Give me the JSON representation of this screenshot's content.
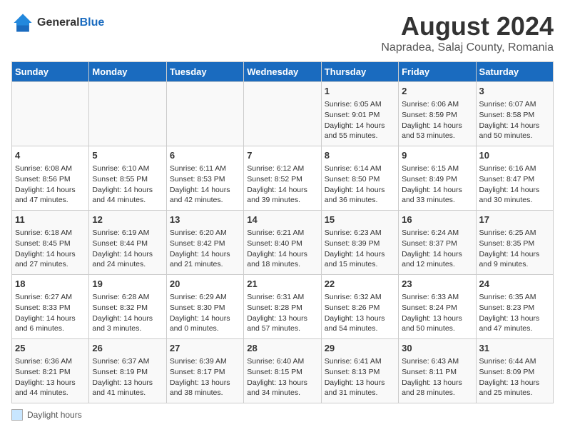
{
  "header": {
    "logo_general": "General",
    "logo_blue": "Blue",
    "main_title": "August 2024",
    "subtitle": "Napradea, Salaj County, Romania"
  },
  "days_of_week": [
    "Sunday",
    "Monday",
    "Tuesday",
    "Wednesday",
    "Thursday",
    "Friday",
    "Saturday"
  ],
  "legend": {
    "label": "Daylight hours"
  },
  "weeks": [
    [
      {
        "day": "",
        "info": ""
      },
      {
        "day": "",
        "info": ""
      },
      {
        "day": "",
        "info": ""
      },
      {
        "day": "",
        "info": ""
      },
      {
        "day": "1",
        "info": "Sunrise: 6:05 AM\nSunset: 9:01 PM\nDaylight: 14 hours\nand 55 minutes."
      },
      {
        "day": "2",
        "info": "Sunrise: 6:06 AM\nSunset: 8:59 PM\nDaylight: 14 hours\nand 53 minutes."
      },
      {
        "day": "3",
        "info": "Sunrise: 6:07 AM\nSunset: 8:58 PM\nDaylight: 14 hours\nand 50 minutes."
      }
    ],
    [
      {
        "day": "4",
        "info": "Sunrise: 6:08 AM\nSunset: 8:56 PM\nDaylight: 14 hours\nand 47 minutes."
      },
      {
        "day": "5",
        "info": "Sunrise: 6:10 AM\nSunset: 8:55 PM\nDaylight: 14 hours\nand 44 minutes."
      },
      {
        "day": "6",
        "info": "Sunrise: 6:11 AM\nSunset: 8:53 PM\nDaylight: 14 hours\nand 42 minutes."
      },
      {
        "day": "7",
        "info": "Sunrise: 6:12 AM\nSunset: 8:52 PM\nDaylight: 14 hours\nand 39 minutes."
      },
      {
        "day": "8",
        "info": "Sunrise: 6:14 AM\nSunset: 8:50 PM\nDaylight: 14 hours\nand 36 minutes."
      },
      {
        "day": "9",
        "info": "Sunrise: 6:15 AM\nSunset: 8:49 PM\nDaylight: 14 hours\nand 33 minutes."
      },
      {
        "day": "10",
        "info": "Sunrise: 6:16 AM\nSunset: 8:47 PM\nDaylight: 14 hours\nand 30 minutes."
      }
    ],
    [
      {
        "day": "11",
        "info": "Sunrise: 6:18 AM\nSunset: 8:45 PM\nDaylight: 14 hours\nand 27 minutes."
      },
      {
        "day": "12",
        "info": "Sunrise: 6:19 AM\nSunset: 8:44 PM\nDaylight: 14 hours\nand 24 minutes."
      },
      {
        "day": "13",
        "info": "Sunrise: 6:20 AM\nSunset: 8:42 PM\nDaylight: 14 hours\nand 21 minutes."
      },
      {
        "day": "14",
        "info": "Sunrise: 6:21 AM\nSunset: 8:40 PM\nDaylight: 14 hours\nand 18 minutes."
      },
      {
        "day": "15",
        "info": "Sunrise: 6:23 AM\nSunset: 8:39 PM\nDaylight: 14 hours\nand 15 minutes."
      },
      {
        "day": "16",
        "info": "Sunrise: 6:24 AM\nSunset: 8:37 PM\nDaylight: 14 hours\nand 12 minutes."
      },
      {
        "day": "17",
        "info": "Sunrise: 6:25 AM\nSunset: 8:35 PM\nDaylight: 14 hours\nand 9 minutes."
      }
    ],
    [
      {
        "day": "18",
        "info": "Sunrise: 6:27 AM\nSunset: 8:33 PM\nDaylight: 14 hours\nand 6 minutes."
      },
      {
        "day": "19",
        "info": "Sunrise: 6:28 AM\nSunset: 8:32 PM\nDaylight: 14 hours\nand 3 minutes."
      },
      {
        "day": "20",
        "info": "Sunrise: 6:29 AM\nSunset: 8:30 PM\nDaylight: 14 hours\nand 0 minutes."
      },
      {
        "day": "21",
        "info": "Sunrise: 6:31 AM\nSunset: 8:28 PM\nDaylight: 13 hours\nand 57 minutes."
      },
      {
        "day": "22",
        "info": "Sunrise: 6:32 AM\nSunset: 8:26 PM\nDaylight: 13 hours\nand 54 minutes."
      },
      {
        "day": "23",
        "info": "Sunrise: 6:33 AM\nSunset: 8:24 PM\nDaylight: 13 hours\nand 50 minutes."
      },
      {
        "day": "24",
        "info": "Sunrise: 6:35 AM\nSunset: 8:23 PM\nDaylight: 13 hours\nand 47 minutes."
      }
    ],
    [
      {
        "day": "25",
        "info": "Sunrise: 6:36 AM\nSunset: 8:21 PM\nDaylight: 13 hours\nand 44 minutes."
      },
      {
        "day": "26",
        "info": "Sunrise: 6:37 AM\nSunset: 8:19 PM\nDaylight: 13 hours\nand 41 minutes."
      },
      {
        "day": "27",
        "info": "Sunrise: 6:39 AM\nSunset: 8:17 PM\nDaylight: 13 hours\nand 38 minutes."
      },
      {
        "day": "28",
        "info": "Sunrise: 6:40 AM\nSunset: 8:15 PM\nDaylight: 13 hours\nand 34 minutes."
      },
      {
        "day": "29",
        "info": "Sunrise: 6:41 AM\nSunset: 8:13 PM\nDaylight: 13 hours\nand 31 minutes."
      },
      {
        "day": "30",
        "info": "Sunrise: 6:43 AM\nSunset: 8:11 PM\nDaylight: 13 hours\nand 28 minutes."
      },
      {
        "day": "31",
        "info": "Sunrise: 6:44 AM\nSunset: 8:09 PM\nDaylight: 13 hours\nand 25 minutes."
      }
    ]
  ]
}
